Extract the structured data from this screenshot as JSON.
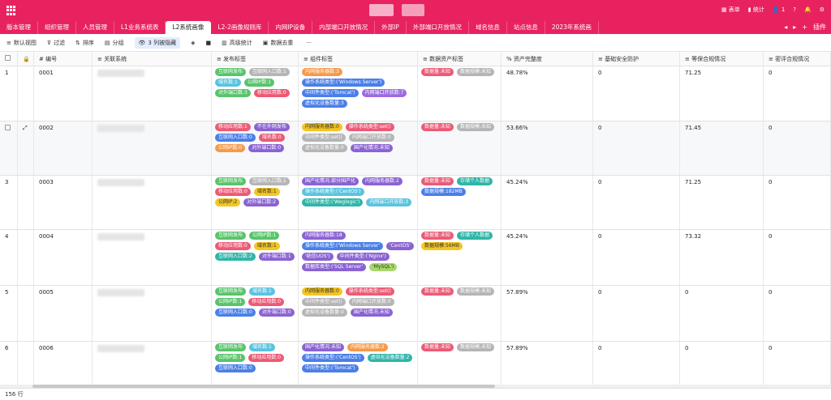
{
  "topbar": {
    "items": [
      "表单",
      "统计",
      "1",
      "?",
      "",
      "⚙"
    ]
  },
  "tabs": [
    "版本管理",
    "组织管理",
    "人员管理",
    "L1业务系统表",
    "L2系统画像",
    "L2-2画像规则库",
    "内网IP设备",
    "内部端口开放情况",
    "外部IP",
    "外部端口开放情况",
    "域名信息",
    "站点信息",
    "2023年系统画"
  ],
  "tab_active_index": 4,
  "tab_right": [
    "◂",
    "▸",
    "+",
    "插件"
  ],
  "toolbar": [
    "默认视图",
    "过滤",
    "排序",
    "分组",
    "3 列被隐藏",
    "",
    "",
    "高级统计",
    "数据去重",
    "···"
  ],
  "columns": [
    "编号",
    "关联系统",
    "发布标签",
    "组件标签",
    "数据资产标签",
    "资产完整度",
    "基础安全防护",
    "等保合规情况",
    "密评合规情况"
  ],
  "rows": [
    {
      "idx": "1",
      "id": "0001",
      "pub": [
        [
          "互联网发布",
          "green"
        ],
        [
          "互联网入口数:1",
          "gray"
        ],
        [
          "域名数:1",
          "cyan"
        ],
        [
          "公网IP数:1",
          "green"
        ],
        [
          "对外端口数:3",
          "green"
        ],
        [
          "移动应用数:0",
          "red"
        ]
      ],
      "comp": [
        [
          "内网服务器数:3",
          "orange"
        ],
        [
          "操作系统类型:('Windows Server')",
          "blue"
        ],
        [
          "中间件类型:('Tomcat')",
          "blue"
        ],
        [
          "内网端口开放数:7",
          "purple"
        ],
        [
          "虚拟化设备数量:3",
          "blue"
        ]
      ],
      "data": [
        [
          "数据量:未知",
          "red"
        ],
        [
          "数据规模:未知",
          "gray"
        ]
      ],
      "complete": "48.78%",
      "basic": "0",
      "dengbao": "71.25",
      "mipin": "0"
    },
    {
      "idx": "",
      "id": "0002",
      "pub": [
        [
          "移动应用数:1",
          "red"
        ],
        [
          "不在外网发布",
          "violet"
        ],
        [
          "互联网入口数:0",
          "blue"
        ],
        [
          "域名数:0",
          "red"
        ],
        [
          "公网IP数:0",
          "orange"
        ],
        [
          "对外端口数:0",
          "violet"
        ]
      ],
      "comp": [
        [
          "内网服务器数:0",
          "yellow"
        ],
        [
          "操作系统类型:set()",
          "red"
        ],
        [
          "中间件类型:set()",
          "gray"
        ],
        [
          "内网端口开放数:0",
          "gray"
        ],
        [
          "虚拟化设备数量:0",
          "gray"
        ],
        [
          "国产化情况:未知",
          "violet"
        ]
      ],
      "data": [
        [
          "数据量:未知",
          "red"
        ],
        [
          "数据规模:未知",
          "gray"
        ]
      ],
      "complete": "53.66%",
      "basic": "0",
      "dengbao": "71.45",
      "mipin": "0"
    },
    {
      "idx": "3",
      "id": "0003",
      "pub": [
        [
          "互联网发布",
          "green"
        ],
        [
          "互联网入口数:1",
          "gray"
        ],
        [
          "移动应用数:0",
          "red"
        ],
        [
          "域名数:1",
          "yellow"
        ],
        [
          "公网IP:2",
          "yellow"
        ],
        [
          "对外端口数:2",
          "violet"
        ]
      ],
      "comp": [
        [
          "国产化情况:部分国产化",
          "violet"
        ],
        [
          "内网服务器数:2",
          "violet"
        ],
        [
          "操作系统类型:('CentOS')",
          "cyan"
        ],
        [
          "中间件类型:('Weglogic')",
          "teal"
        ],
        [
          "内网端口开放数:3",
          "cyan"
        ]
      ],
      "data": [
        [
          "数据量:未知",
          "red"
        ],
        [
          "存储个人数据",
          "teal"
        ],
        [
          "数据规模:182MB",
          "blue"
        ]
      ],
      "complete": "45.24%",
      "basic": "0",
      "dengbao": "71.25",
      "mipin": "0"
    },
    {
      "idx": "4",
      "id": "0004",
      "pub": [
        [
          "互联网发布",
          "green"
        ],
        [
          "公网IP数:1",
          "green"
        ],
        [
          "移动应用数:0",
          "red"
        ],
        [
          "域名数:1",
          "yellow"
        ],
        [
          "互联网入口数:2",
          "teal"
        ],
        [
          "对外端口数:1",
          "violet"
        ]
      ],
      "comp": [
        [
          "内网服务器数:18",
          "violet"
        ],
        [
          "操作系统类型:('Windows Server'",
          "blue"
        ],
        [
          "'CentOS'",
          "violet"
        ],
        [
          "'统信UOS')",
          "violet"
        ],
        [
          "中间件类型:('Nginx')",
          "violet"
        ],
        [
          "数据库类型:('SQL Server'",
          "violet"
        ],
        [
          "'MySQL')",
          "lime"
        ]
      ],
      "data": [
        [
          "数据量:未知",
          "red"
        ],
        [
          "存储个人数据",
          "teal"
        ],
        [
          "数据规模:56MB",
          "yellow"
        ]
      ],
      "complete": "45.24%",
      "basic": "0",
      "dengbao": "73.32",
      "mipin": "0"
    },
    {
      "idx": "5",
      "id": "0005",
      "pub": [
        [
          "互联网发布",
          "green"
        ],
        [
          "域名数:1",
          "cyan"
        ],
        [
          "公网IP数:1",
          "green"
        ],
        [
          "移动应用数:0",
          "red"
        ],
        [
          "互联网入口数:0",
          "blue"
        ],
        [
          "对外端口数:0",
          "violet"
        ]
      ],
      "comp": [
        [
          "内网服务器数:0",
          "yellow"
        ],
        [
          "操作系统类型:set()",
          "red"
        ],
        [
          "中间件类型:set()",
          "gray"
        ],
        [
          "内网端口开放数:0",
          "gray"
        ],
        [
          "虚拟化设备数量:0",
          "gray"
        ],
        [
          "国产化情况:未知",
          "violet"
        ]
      ],
      "data": [
        [
          "数据量:未知",
          "red"
        ],
        [
          "数据规模:未知",
          "gray"
        ]
      ],
      "complete": "57.89%",
      "basic": "0",
      "dengbao": "0",
      "mipin": "0"
    },
    {
      "idx": "6",
      "id": "0006",
      "pub": [
        [
          "互联网发布",
          "green"
        ],
        [
          "域名数:1",
          "cyan"
        ],
        [
          "公网IP数:1",
          "green"
        ],
        [
          "移动应用数:0",
          "red"
        ],
        [
          "互联网入口数:0",
          "blue"
        ]
      ],
      "comp": [
        [
          "国产化情况:未知",
          "violet"
        ],
        [
          "内网服务器数:2",
          "orange"
        ],
        [
          "操作系统类型:('CentOS')",
          "blue"
        ],
        [
          "虚拟化设备数量:2",
          "teal"
        ],
        [
          "中间件类型:('Tomcat')",
          "blue"
        ]
      ],
      "data": [
        [
          "数据量:未知",
          "red"
        ],
        [
          "数据规模:未知",
          "gray"
        ]
      ],
      "complete": "57.89%",
      "basic": "0",
      "dengbao": "0",
      "mipin": "0"
    }
  ],
  "footer": "156 行"
}
